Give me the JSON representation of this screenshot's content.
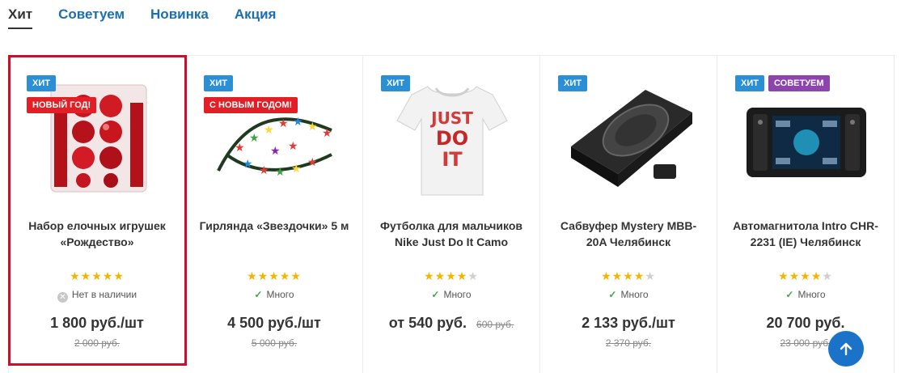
{
  "tabs": [
    {
      "label": "Хит",
      "active": true
    },
    {
      "label": "Советуем",
      "active": false
    },
    {
      "label": "Новинка",
      "active": false
    },
    {
      "label": "Акция",
      "active": false
    }
  ],
  "products": [
    {
      "badges": [
        [
          "ХИТ"
        ],
        [
          "НОВЫЙ ГОД!"
        ]
      ],
      "name": "Набор елочных игрушек «Рождество»",
      "rating": 5,
      "stock": "Нет в наличии",
      "in_stock": false,
      "price": "1 800 руб./шт",
      "old_price": "2 000 руб.",
      "image": "ornaments-box-image"
    },
    {
      "badges": [
        [
          "ХИТ"
        ],
        [
          "С НОВЫМ ГОДОМ!"
        ]
      ],
      "name": "Гирлянда «Звездочки» 5 м",
      "rating": 5,
      "stock": "Много",
      "in_stock": true,
      "price": "4 500 руб./шт",
      "old_price": "5 000 руб.",
      "image": "garland-image"
    },
    {
      "badges": [
        [
          "ХИТ"
        ]
      ],
      "name": "Футболка для мальчиков Nike Just Do It Camo",
      "rating": 4,
      "stock": "Много",
      "in_stock": true,
      "price": "от 540 руб.",
      "old_price": "600 руб.",
      "image": "tshirt-image"
    },
    {
      "badges": [
        [
          "ХИТ"
        ]
      ],
      "name": "Сабвуфер Mystery MBB-20A Челябинск",
      "rating": 4,
      "stock": "Много",
      "in_stock": true,
      "price": "2 133 руб./шт",
      "old_price": "2 370 руб.",
      "image": "subwoofer-image"
    },
    {
      "badges": [
        [
          "ХИТ",
          "СОВЕТУЕМ"
        ]
      ],
      "name": "Автомагнитола Intro CHR-2231 (IE) Челябинск",
      "rating": 4,
      "stock": "Много",
      "in_stock": true,
      "price": "20 700 руб.",
      "old_price": "23 000 руб.",
      "image": "car-stereo-image"
    }
  ],
  "colors": {
    "link": "#1a6fb0",
    "hit_badge": "#2b8fd6",
    "sale_badge": "#e21e26",
    "recommend_badge": "#8e44ad",
    "star": "#f5b400",
    "selection": "#c8102e",
    "up_button": "#1a73c9"
  },
  "scroll_up_icon": "arrow-up-icon"
}
